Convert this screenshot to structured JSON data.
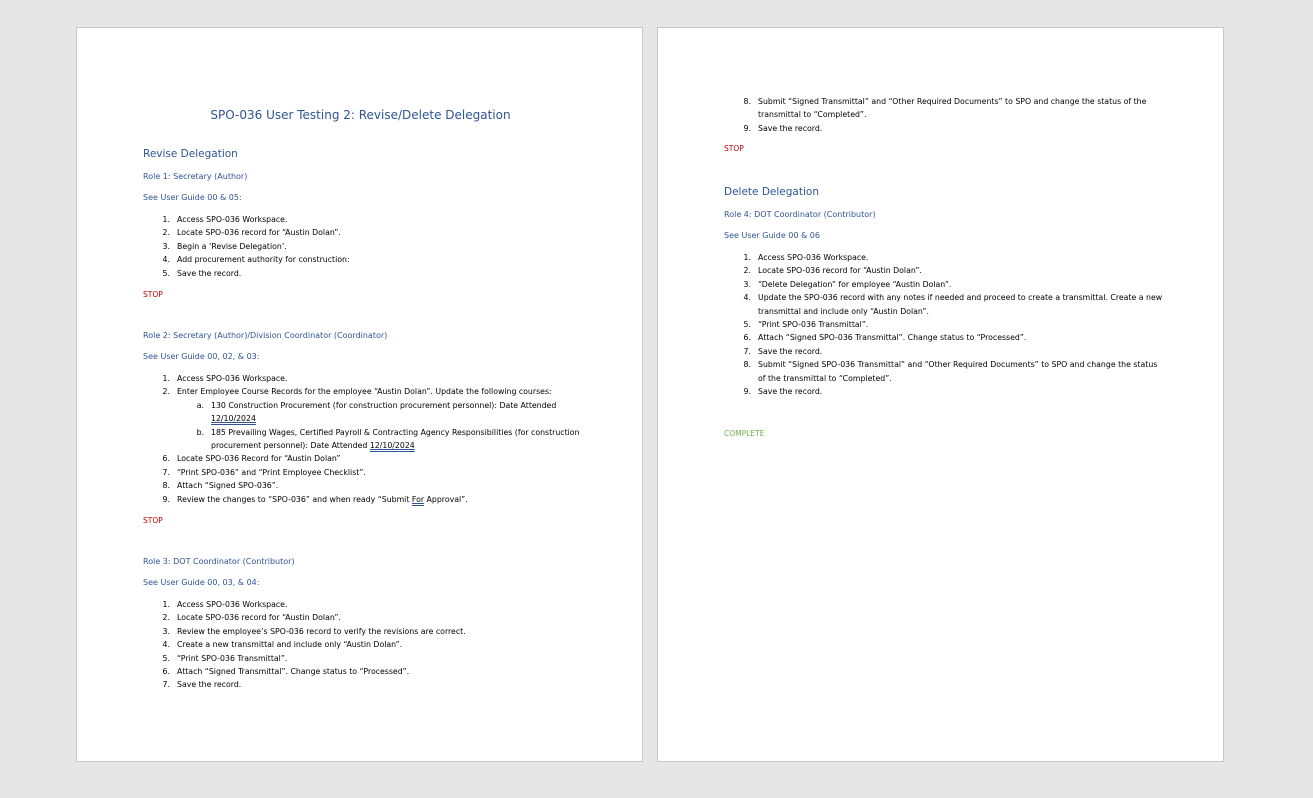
{
  "document": {
    "title": "SPO-036 User Testing 2: Revise/Delete Delegation",
    "stop_label": "STOP",
    "complete_label": "COMPLETE",
    "revise": {
      "heading": "Revise Delegation",
      "role1": {
        "title": "Role 1: Secretary (Author)",
        "guide": "See User Guide 00 & 05:",
        "steps": [
          {
            "num": "1.",
            "text": "Access SPO-036 Workspace."
          },
          {
            "num": "2.",
            "text": "Locate SPO-036 record for “Austin Dolan”."
          },
          {
            "num": "3.",
            "text": "Begin a ‘Revise Delegation’."
          },
          {
            "num": "4.",
            "text": "Add procurement authority for construction:"
          },
          {
            "num": "5.",
            "text": "Save the record."
          }
        ]
      },
      "role2": {
        "title": "Role 2: Secretary (Author)/Division Coordinator (Coordinator)",
        "guide": "See User Guide 00, 02, & 03:",
        "steps_a": [
          {
            "num": "1.",
            "text": "Access SPO-036 Workspace."
          },
          {
            "num": "2.",
            "text": "Enter Employee Course Records for the employee “Austin Dolan”. Update the following courses:"
          }
        ],
        "substeps": [
          {
            "num": "a.",
            "text": "130 Construction Procurement (for construction procurement personnel): Date Attended",
            "date": "12/10/2024"
          },
          {
            "num": "b.",
            "text": "185 Prevailing Wages, Certified Payroll & Contracting Agency Responsibilities (for construction procurement personnel): Date Attended",
            "date": "12/10/2024"
          }
        ],
        "steps_b": [
          {
            "num": "6.",
            "text": "Locate SPO-036 Record for “Austin Dolan”"
          },
          {
            "num": "7.",
            "text": "“Print SPO-036” and “Print Employee Checklist”."
          },
          {
            "num": "8.",
            "text": "Attach “Signed SPO-036”."
          }
        ],
        "step9": {
          "num": "9.",
          "before": "Review the changes to “SPO-036” and when ready “Submit ",
          "underlined": "For",
          "after": " Approval”."
        }
      },
      "role3": {
        "title": "Role 3: DOT Coordinator (Contributor)",
        "guide": "See User Guide 00, 03, & 04:",
        "steps": [
          {
            "num": "1.",
            "text": "Access SPO-036 Workspace."
          },
          {
            "num": "2.",
            "text": "Locate SPO-036 record for “Austin Dolan”."
          },
          {
            "num": "3.",
            "text": "Review the employee’s SPO-036 record to verify the revisions are correct."
          },
          {
            "num": "4.",
            "text": "Create a new transmittal and include only “Austin Dolan”."
          },
          {
            "num": "5.",
            "text": "“Print SPO-036 Transmittal”."
          },
          {
            "num": "6.",
            "text": "Attach “Signed Transmittal”. Change status to “Processed”."
          },
          {
            "num": "7.",
            "text": "Save the record."
          }
        ],
        "continued_steps": [
          {
            "num": "8.",
            "text": "Submit “Signed Transmittal” and “Other Required Documents” to SPO and change the status of the transmittal to “Completed”."
          },
          {
            "num": "9.",
            "text": "Save the record."
          }
        ]
      }
    },
    "delete": {
      "heading": "Delete Delegation",
      "role4": {
        "title": "Role 4: DOT Coordinator (Contributor)",
        "guide": "See User Guide 00 & 06",
        "steps": [
          {
            "num": "1.",
            "text": "Access SPO-036 Workspace."
          },
          {
            "num": "2.",
            "text": "Locate SPO-036 record for “Austin Dolan”."
          },
          {
            "num": "3.",
            "text": "“Delete Delegation” for employee “Austin Dolan”."
          },
          {
            "num": "4.",
            "text": "Update the SPO-036 record with any notes if needed and proceed to create a transmittal. Create a new transmittal and include only “Austin Dolan”."
          },
          {
            "num": "5.",
            "text": "“Print SPO-036 Transmittal”."
          },
          {
            "num": "6.",
            "text": "Attach “Signed SPO-036 Transmittal”. Change status to “Processed”."
          },
          {
            "num": "7.",
            "text": "Save the record."
          },
          {
            "num": "8.",
            "text": "Submit “Signed SPO-036 Transmittal” and “Other Required Documents” to SPO and change the status of the transmittal to “Completed”."
          },
          {
            "num": "9.",
            "text": "Save the record."
          }
        ]
      }
    }
  }
}
